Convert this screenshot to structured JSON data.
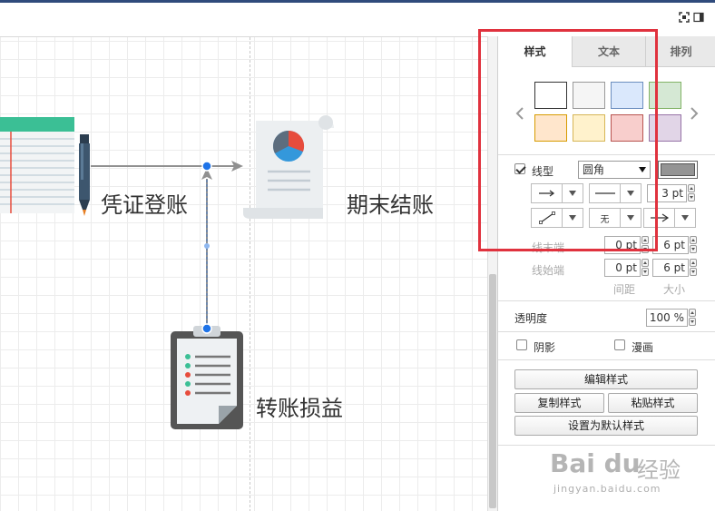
{
  "diagram": {
    "nodes": [
      {
        "id": "voucher",
        "label": "凭证登账"
      },
      {
        "id": "period_close",
        "label": "期末结账"
      },
      {
        "id": "transfer",
        "label": "转账损益"
      }
    ]
  },
  "format_panel": {
    "tabs": [
      {
        "label": "样式",
        "active": true
      },
      {
        "label": "文本",
        "active": false
      },
      {
        "label": "排列",
        "active": false
      }
    ],
    "swatches": [
      {
        "fill": "#ffffff",
        "border": "#333333",
        "selected": true
      },
      {
        "fill": "#f5f5f5",
        "border": "#999999"
      },
      {
        "fill": "#dae8fc",
        "border": "#6c8ebf"
      },
      {
        "fill": "#d5e8d4",
        "border": "#82b366"
      },
      {
        "fill": "#ffe6cc",
        "border": "#d79b00"
      },
      {
        "fill": "#fff2cc",
        "border": "#d6b656"
      },
      {
        "fill": "#f8cecc",
        "border": "#b85450"
      },
      {
        "fill": "#e1d5e7",
        "border": "#9673a6"
      }
    ],
    "line": {
      "label": "线型",
      "checked": true,
      "style_value": "圆角",
      "color": "#949494",
      "width": "3 pt",
      "waypoint_none": "无"
    },
    "line_end": {
      "label": "线末端",
      "spacing": "0 pt",
      "size": "6 pt"
    },
    "line_start": {
      "label": "线始端",
      "spacing": "0 pt",
      "size": "6 pt"
    },
    "spacing_header": "间距",
    "size_header": "大小",
    "opacity": {
      "label": "透明度",
      "value": "100 %"
    },
    "shadow": {
      "label": "阴影",
      "checked": false
    },
    "sketch": {
      "label": "漫画",
      "checked": false
    },
    "buttons": {
      "edit_style": "编辑样式",
      "copy_style": "复制样式",
      "paste_style": "粘贴样式",
      "set_default": "设置为默认样式"
    }
  },
  "watermark": {
    "logo": "Bai du",
    "suffix": "经验",
    "url": "jingyan.baidu.com"
  },
  "colors": {
    "highlight": "#e0323e",
    "selection": "#1e73e8",
    "connector": "#909090"
  }
}
